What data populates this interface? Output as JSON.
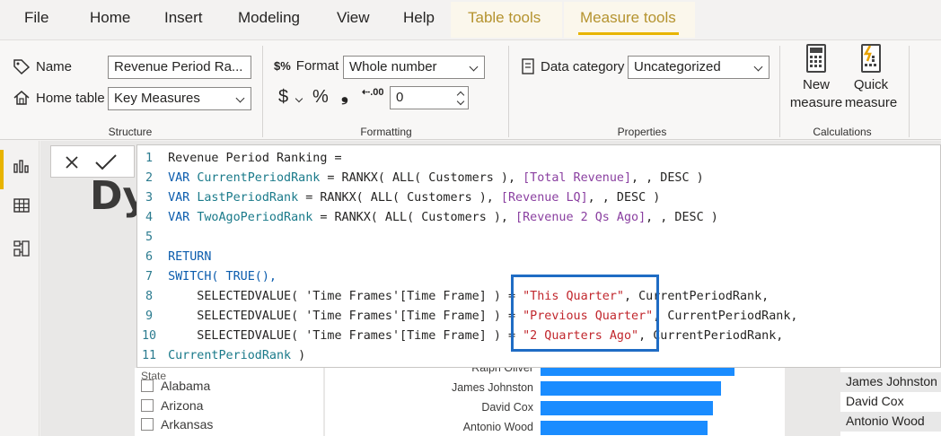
{
  "tabs": {
    "file": "File",
    "home": "Home",
    "insert": "Insert",
    "modeling": "Modeling",
    "view": "View",
    "help": "Help",
    "table_tools": "Table tools",
    "measure_tools": "Measure tools"
  },
  "structure": {
    "name_label": "Name",
    "name_value": "Revenue Period Ra...",
    "home_table_label": "Home table",
    "home_table_value": "Key Measures",
    "group_label": "Structure"
  },
  "formatting": {
    "format_label": "Format",
    "format_value": "Whole number",
    "currency_symbol": "$",
    "percent_symbol": "%",
    "comma_symbol": "❟",
    "decimal_symbol": ".00",
    "decimals_value": "0",
    "group_label": "Formatting"
  },
  "properties": {
    "data_category_label": "Data category",
    "data_category_value": "Uncategorized",
    "group_label": "Properties"
  },
  "calculations": {
    "new_measure_line1": "New",
    "new_measure_line2": "measure",
    "quick_measure_line1": "Quick",
    "quick_measure_line2": "measure",
    "group_label": "Calculations"
  },
  "canvas_title_fragment": "Dy",
  "editor": {
    "line_numbers": [
      "1",
      "2",
      "3",
      "4",
      "5",
      "6",
      "7",
      "8",
      "9",
      "10",
      "11"
    ],
    "l1": "Revenue Period Ranking =",
    "l2_kw": "VAR",
    "l2_var": "CurrentPeriodRank",
    "l2_rest": " = RANKX( ALL( Customers ), ",
    "l2_ref": "[Total Revenue]",
    "l2_end": ", , DESC )",
    "l3_kw": "VAR",
    "l3_var": "LastPeriodRank",
    "l3_rest": " = RANKX( ALL( Customers ), ",
    "l3_ref": "[Revenue LQ]",
    "l3_end": ", , DESC )",
    "l4_kw": "VAR",
    "l4_var": "TwoAgoPeriodRank",
    "l4_rest": " = RANKX( ALL( Customers ), ",
    "l4_ref": "[Revenue 2 Qs Ago]",
    "l4_end": ", , DESC )",
    "l6": "RETURN",
    "l7": "SWITCH( TRUE(),",
    "sel": "    SELECTEDVALUE( 'Time Frames'[Time Frame] ) = ",
    "l8_str": "\"This Quarter\"",
    "l9_str": "\"Previous Quarter\"",
    "l10_str": "\"2 Quarters Ago\"",
    "comma_rank": ", CurrentPeriodRank,",
    "l11_var": "CurrentPeriodRank",
    "l11_end": " )"
  },
  "slicer": {
    "header": "State",
    "items": [
      "Alabama",
      "Arizona",
      "Arkansas"
    ]
  },
  "chart_data": {
    "type": "bar",
    "categories": [
      "Ralph Oliver",
      "James Johnston",
      "David Cox",
      "Antonio Wood"
    ],
    "values": [
      100,
      93,
      89,
      86
    ]
  },
  "table": {
    "rows": [
      "",
      "James Johnston",
      "David Cox",
      "Antonio Wood"
    ]
  }
}
